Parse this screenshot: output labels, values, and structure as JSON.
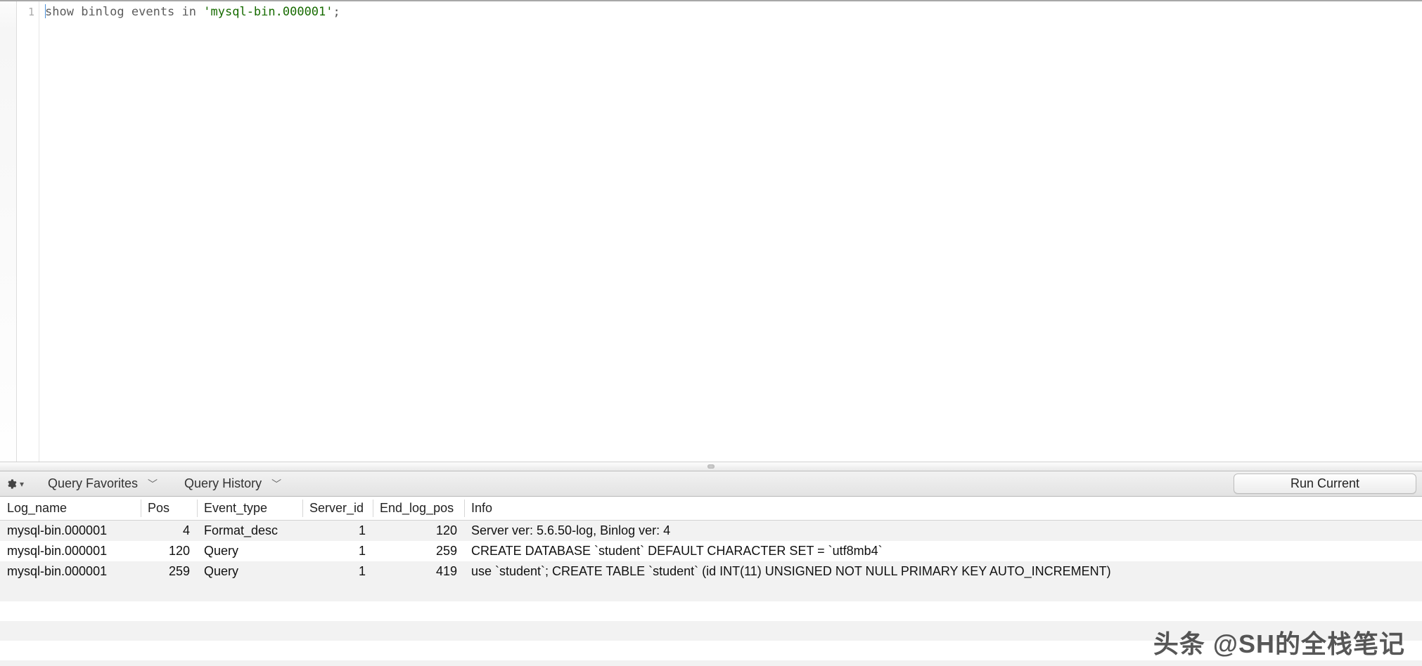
{
  "editor": {
    "line_number": "1",
    "tokens": {
      "kw1": "show",
      "kw2": "binlog",
      "kw3": "events",
      "kw4": "in",
      "str": "'mysql-bin.000001'",
      "semi": ";"
    }
  },
  "toolbar": {
    "favorites_label": "Query Favorites",
    "history_label": "Query History",
    "run_label": "Run Current"
  },
  "results": {
    "columns": {
      "log_name": "Log_name",
      "pos": "Pos",
      "event_type": "Event_type",
      "server_id": "Server_id",
      "end_log_pos": "End_log_pos",
      "info": "Info"
    },
    "rows": [
      {
        "log_name": "mysql-bin.000001",
        "pos": "4",
        "event_type": "Format_desc",
        "server_id": "1",
        "end_log_pos": "120",
        "info": "Server ver: 5.6.50-log, Binlog ver: 4"
      },
      {
        "log_name": "mysql-bin.000001",
        "pos": "120",
        "event_type": "Query",
        "server_id": "1",
        "end_log_pos": "259",
        "info": "CREATE DATABASE `student` DEFAULT CHARACTER SET = `utf8mb4`"
      },
      {
        "log_name": "mysql-bin.000001",
        "pos": "259",
        "event_type": "Query",
        "server_id": "1",
        "end_log_pos": "419",
        "info": "use `student`; CREATE TABLE `student` (id INT(11) UNSIGNED NOT NULL PRIMARY KEY AUTO_INCREMENT)"
      }
    ]
  },
  "watermark": "头条 @SH的全栈笔记"
}
